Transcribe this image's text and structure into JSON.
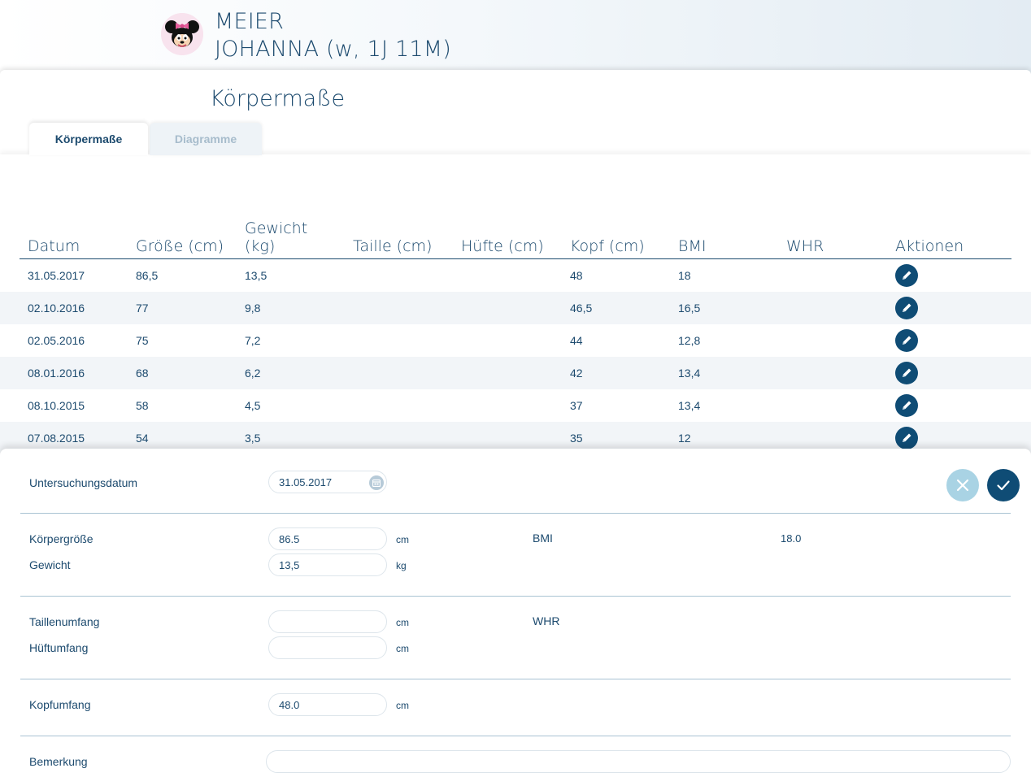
{
  "patient": {
    "last_name": "MEIER",
    "first_line": "JOHANNA (w, 1J 11M)"
  },
  "page": {
    "title": "Körpermaße"
  },
  "tabs": [
    {
      "label": "Körpermaße",
      "active": true
    },
    {
      "label": "Diagramme",
      "active": false
    }
  ],
  "table": {
    "columns": [
      "Datum",
      "Größe (cm)",
      "Gewicht (kg)",
      "Taille (cm)",
      "Hüfte (cm)",
      "Kopf (cm)",
      "BMI",
      "WHR",
      "Aktionen"
    ],
    "rows": [
      {
        "datum": "31.05.2017",
        "groesse": "86,5",
        "gewicht": "13,5",
        "taille": "",
        "huefte": "",
        "kopf": "48",
        "bmi": "18",
        "whr": ""
      },
      {
        "datum": "02.10.2016",
        "groesse": "77",
        "gewicht": "9,8",
        "taille": "",
        "huefte": "",
        "kopf": "46,5",
        "bmi": "16,5",
        "whr": ""
      },
      {
        "datum": "02.05.2016",
        "groesse": "75",
        "gewicht": "7,2",
        "taille": "",
        "huefte": "",
        "kopf": "44",
        "bmi": "12,8",
        "whr": ""
      },
      {
        "datum": "08.01.2016",
        "groesse": "68",
        "gewicht": "6,2",
        "taille": "",
        "huefte": "",
        "kopf": "42",
        "bmi": "13,4",
        "whr": ""
      },
      {
        "datum": "08.10.2015",
        "groesse": "58",
        "gewicht": "4,5",
        "taille": "",
        "huefte": "",
        "kopf": "37",
        "bmi": "13,4",
        "whr": ""
      },
      {
        "datum": "07.08.2015",
        "groesse": "54",
        "gewicht": "3,5",
        "taille": "",
        "huefte": "",
        "kopf": "35",
        "bmi": "12",
        "whr": ""
      }
    ]
  },
  "form": {
    "untersuchungsdatum_label": "Untersuchungsdatum",
    "untersuchungsdatum_value": "31.05.2017",
    "koerpergroesse_label": "Körpergröße",
    "koerpergroesse_value": "86.5",
    "koerpergroesse_unit": "cm",
    "gewicht_label": "Gewicht",
    "gewicht_value": "13,5",
    "gewicht_unit": "kg",
    "bmi_label": "BMI",
    "bmi_value": "18.0",
    "taillenumfang_label": "Taillenumfang",
    "taillenumfang_value": "",
    "taillenumfang_unit": "cm",
    "hueftumfang_label": "Hüftumfang",
    "hueftumfang_value": "",
    "hueftumfang_unit": "cm",
    "whr_label": "WHR",
    "kopfumfang_label": "Kopfumfang",
    "kopfumfang_value": "48.0",
    "kopfumfang_unit": "cm",
    "bemerkung_label": "Bemerkung",
    "bemerkung_value": ""
  },
  "icons": {
    "avatar": "minnie-mouse-avatar",
    "edit": "pencil-icon",
    "calendar": "calendar-icon",
    "cancel": "close-icon",
    "confirm": "checkmark-icon"
  },
  "colors": {
    "primary": "#0f4c75",
    "text": "#1c4a6e",
    "cancel_button": "#a9d3e4",
    "row_alt": "#f2f5f8"
  }
}
